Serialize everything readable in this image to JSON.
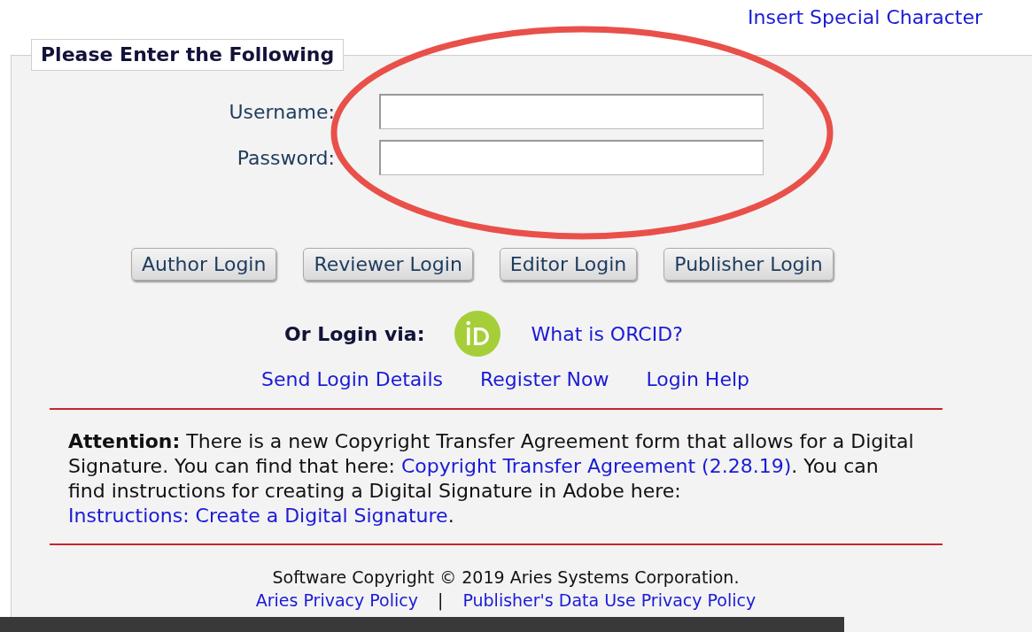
{
  "top_link": "Insert Special Character",
  "form": {
    "legend": "Please Enter the Following",
    "fields": [
      {
        "label": "Username:"
      },
      {
        "label": "Password:"
      }
    ],
    "buttons": [
      "Author Login",
      "Reviewer Login",
      "Editor Login",
      "Publisher Login"
    ],
    "orcid": {
      "label": "Or Login via:",
      "link": "What is ORCID?"
    },
    "links": [
      "Send Login Details",
      "Register Now",
      "Login Help"
    ],
    "notice": [
      {
        "kind": "text",
        "text": "**Attention:** There is a new Copyright Transfer Agreement form that allows for a Digital Signature. You can find that here: "
      },
      {
        "kind": "link",
        "text": "Copyright Transfer Agreement"
      },
      {
        "kind": "link",
        "text": "(2.28.19)"
      },
      {
        "kind": "text",
        "text": ". You can find instructions for creating a Digital Signature in Adobe here: "
      },
      {
        "kind": "link",
        "text": "Instructions: Create a Digital Signature"
      },
      {
        "kind": "text",
        "text": "."
      }
    ],
    "footer": {
      "copyright": "Software Copyright © 2019 Aries Systems Corporation.",
      "links": [
        "Aries Privacy Policy",
        "Publisher's Data Use Privacy Policy"
      ],
      "separator": "|"
    }
  }
}
